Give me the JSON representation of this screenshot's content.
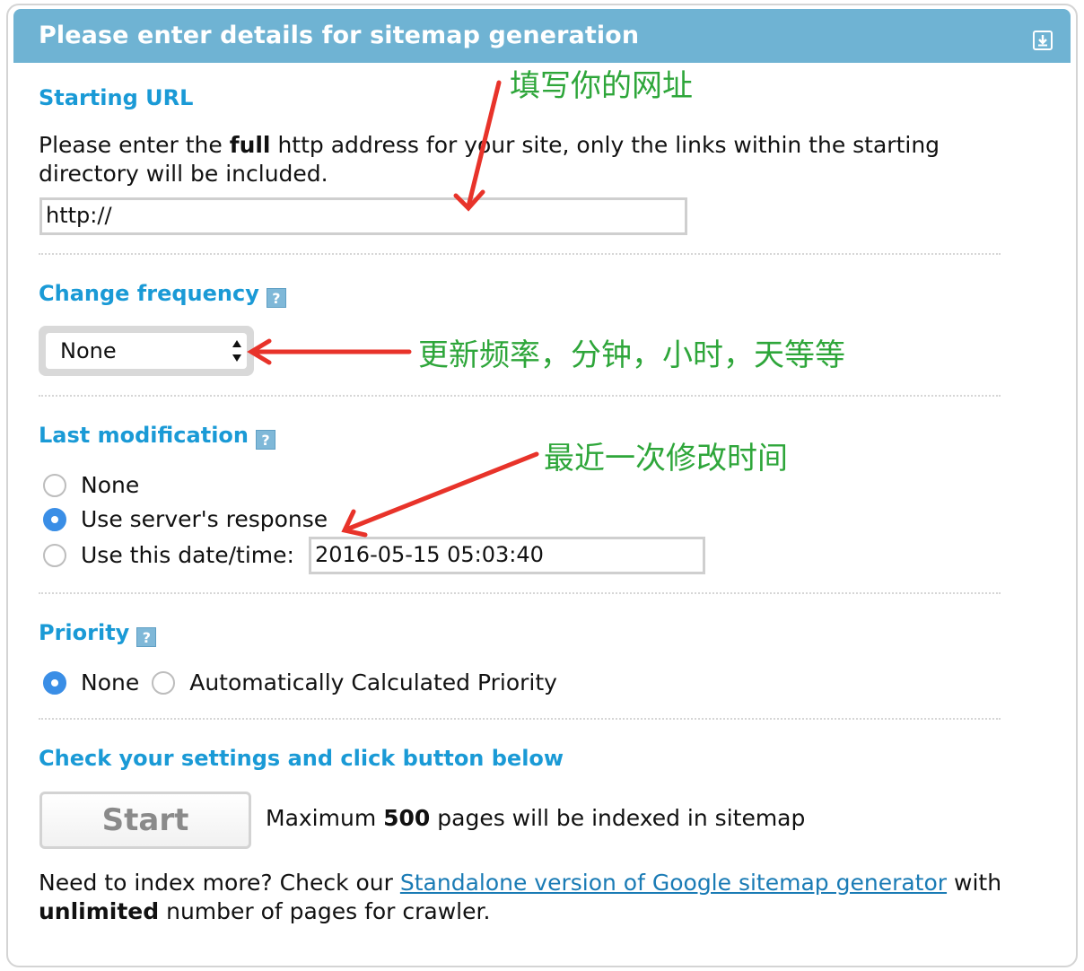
{
  "panel": {
    "title": "Please enter details for sitemap generation",
    "collapse_icon": "collapse-down-icon"
  },
  "starting_url": {
    "heading": "Starting URL",
    "desc_pre": "Please enter the ",
    "desc_bold": "full",
    "desc_post": " http address for your site, only the links within the starting directory will be included.",
    "value": "http://"
  },
  "change_frequency": {
    "heading": "Change frequency",
    "help": "?",
    "selected": "None"
  },
  "last_modification": {
    "heading": "Last modification",
    "help": "?",
    "options": [
      "None",
      "Use server's response",
      "Use this date/time:"
    ],
    "selected_index": 1,
    "datetime_value": "2016-05-15 05:03:40"
  },
  "priority": {
    "heading": "Priority",
    "help": "?",
    "options": [
      "None",
      "Automatically Calculated Priority"
    ],
    "selected_index": 0
  },
  "check": {
    "heading": "Check your settings and click button below",
    "start_label": "Start",
    "max_pre": "Maximum ",
    "max_bold": "500",
    "max_post": " pages will be indexed in sitemap"
  },
  "footer": {
    "pre": "Need to index more? Check our ",
    "link_text": "Standalone version of Google sitemap generator",
    "post": " with ",
    "bold": "unlimited",
    "end": " number of pages for crawler."
  },
  "annotations": {
    "url_note": "填写你的网址",
    "freq_note": "更新频率，分钟，小时，天等等",
    "lastmod_note": "最近一次修改时间"
  },
  "colors": {
    "header": "#6fb3d3",
    "heading": "#1a9ad6",
    "annotation": "#2ea63a",
    "arrow": "#e8332a",
    "radio_checked": "#3a8ee6"
  }
}
